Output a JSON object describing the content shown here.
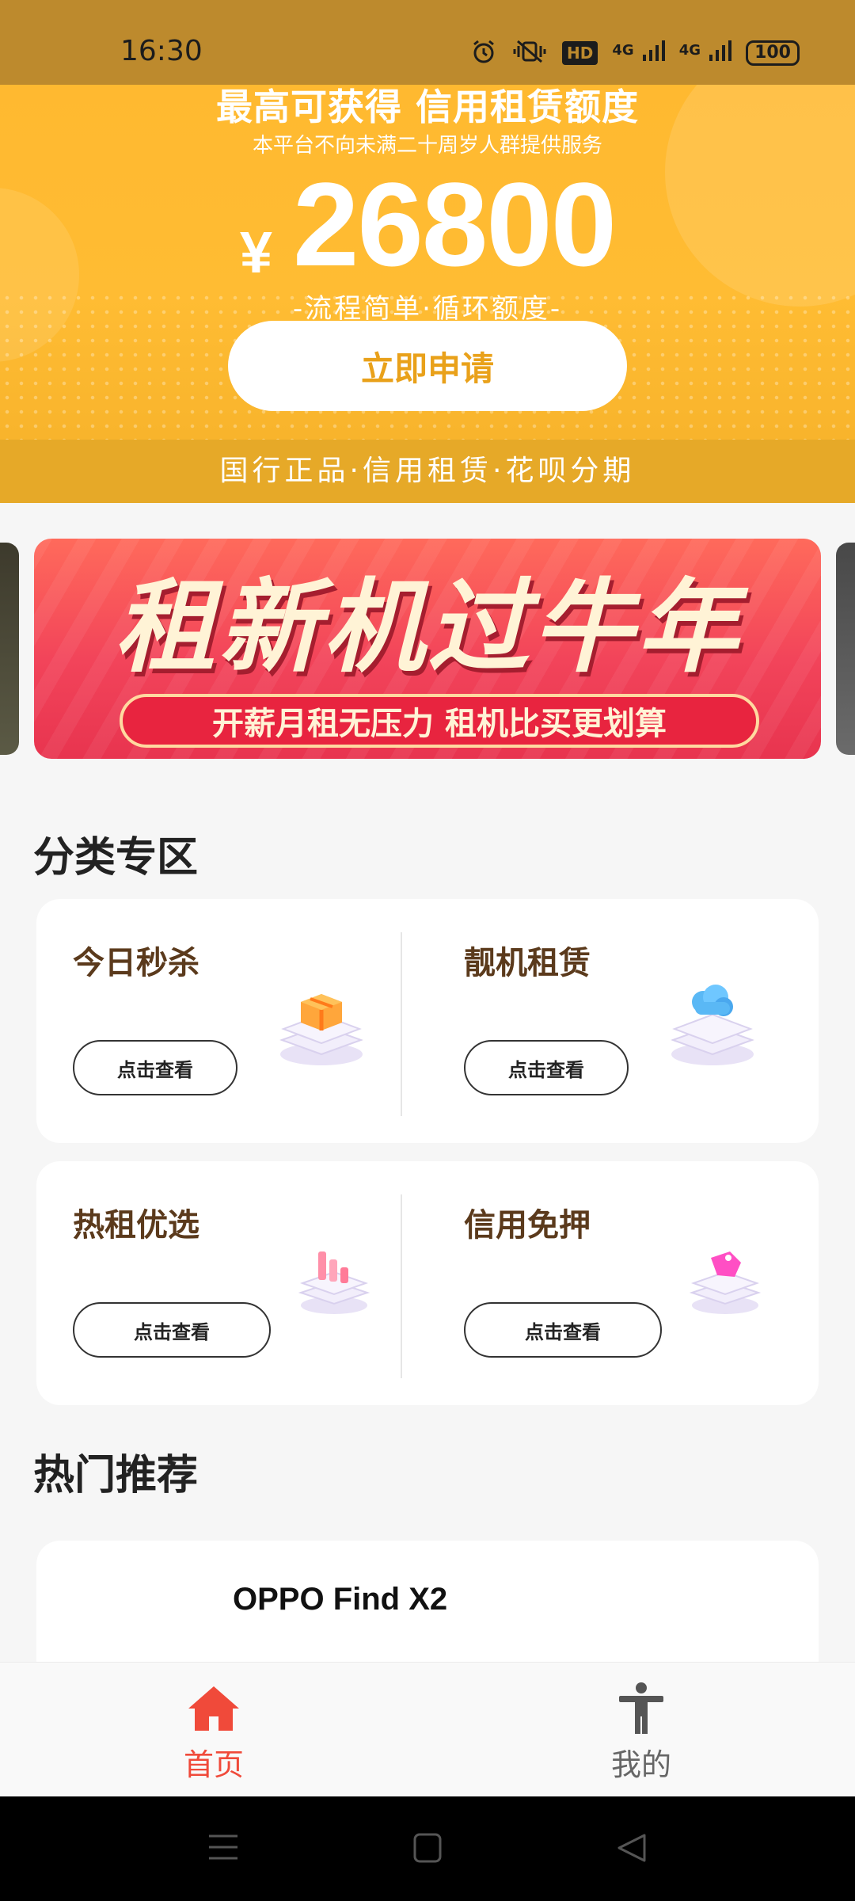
{
  "status_bar": {
    "time": "16:30",
    "icons": [
      "alarm-icon",
      "vibrate-mute-icon",
      "hd-icon",
      "signal-4g-icon",
      "signal-4g-icon",
      "battery-icon"
    ],
    "hd_label": "HD",
    "network_1": "4G",
    "network_2": "4G",
    "battery": "100"
  },
  "hero": {
    "title": "最高可获得 信用租赁额度",
    "subtitle": "本平台不向未满二十周岁人群提供服务",
    "currency": "¥",
    "amount": "26800",
    "tagline": "-流程简单·循环额度-",
    "apply_label": "立即申请",
    "strip_text": "国行正品·信用租赁·花呗分期"
  },
  "banner": {
    "title": "租新机过牛年",
    "subtitle": "开薪月租无压力    租机比买更划算"
  },
  "category_section": {
    "title": "分类专区",
    "items": [
      {
        "name": "今日秒杀",
        "button": "点击查看",
        "icon": "gift-box-icon"
      },
      {
        "name": "靓机租赁",
        "button": "点击查看",
        "icon": "cloud-icon"
      },
      {
        "name": "热租优选",
        "button": "点击查看",
        "icon": "bar-chart-icon"
      },
      {
        "name": "信用免押",
        "button": "点击查看",
        "icon": "tag-icon"
      }
    ]
  },
  "hot_section": {
    "title": "热门推荐",
    "items": [
      {
        "name": "OPPO Find X2"
      }
    ]
  },
  "tabbar": {
    "tabs": [
      {
        "label": "首页",
        "icon": "home-icon",
        "active": true
      },
      {
        "label": "我的",
        "icon": "person-icon",
        "active": false
      }
    ]
  },
  "colors": {
    "accent": "#f04a3a",
    "hero": "#ffb930",
    "status_bar": "#bd8a2d"
  }
}
